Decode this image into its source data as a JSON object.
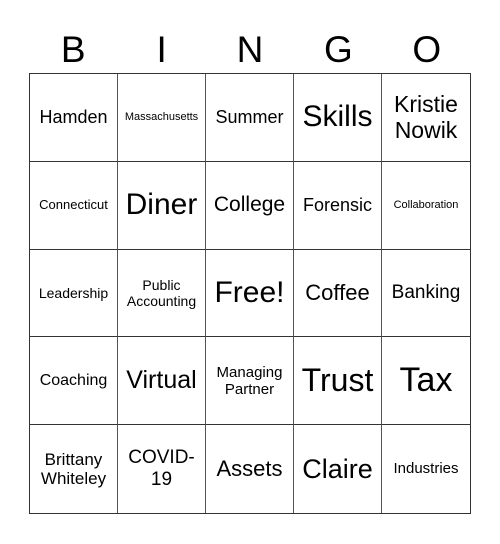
{
  "header": {
    "letters": [
      "B",
      "I",
      "N",
      "G",
      "O"
    ]
  },
  "cells": [
    {
      "text": "Hamden",
      "size": 18
    },
    {
      "text": "Massachusetts",
      "size": 11
    },
    {
      "text": "Summer",
      "size": 18
    },
    {
      "text": "Skills",
      "size": 30
    },
    {
      "text": "Kristie Nowik",
      "size": 23
    },
    {
      "text": "Connecticut",
      "size": 13
    },
    {
      "text": "Diner",
      "size": 30
    },
    {
      "text": "College",
      "size": 21
    },
    {
      "text": "Forensic",
      "size": 18
    },
    {
      "text": "Collaboration",
      "size": 11
    },
    {
      "text": "Leadership",
      "size": 14
    },
    {
      "text": "Public Accounting",
      "size": 14
    },
    {
      "text": "Free!",
      "size": 30
    },
    {
      "text": "Coffee",
      "size": 22
    },
    {
      "text": "Banking",
      "size": 19
    },
    {
      "text": "Coaching",
      "size": 16
    },
    {
      "text": "Virtual",
      "size": 25
    },
    {
      "text": "Managing Partner",
      "size": 15
    },
    {
      "text": "Trust",
      "size": 32
    },
    {
      "text": "Tax",
      "size": 34
    },
    {
      "text": "Brittany Whiteley",
      "size": 17
    },
    {
      "text": "COVID-19",
      "size": 19
    },
    {
      "text": "Assets",
      "size": 22
    },
    {
      "text": "Claire",
      "size": 27
    },
    {
      "text": "Industries",
      "size": 15
    }
  ]
}
